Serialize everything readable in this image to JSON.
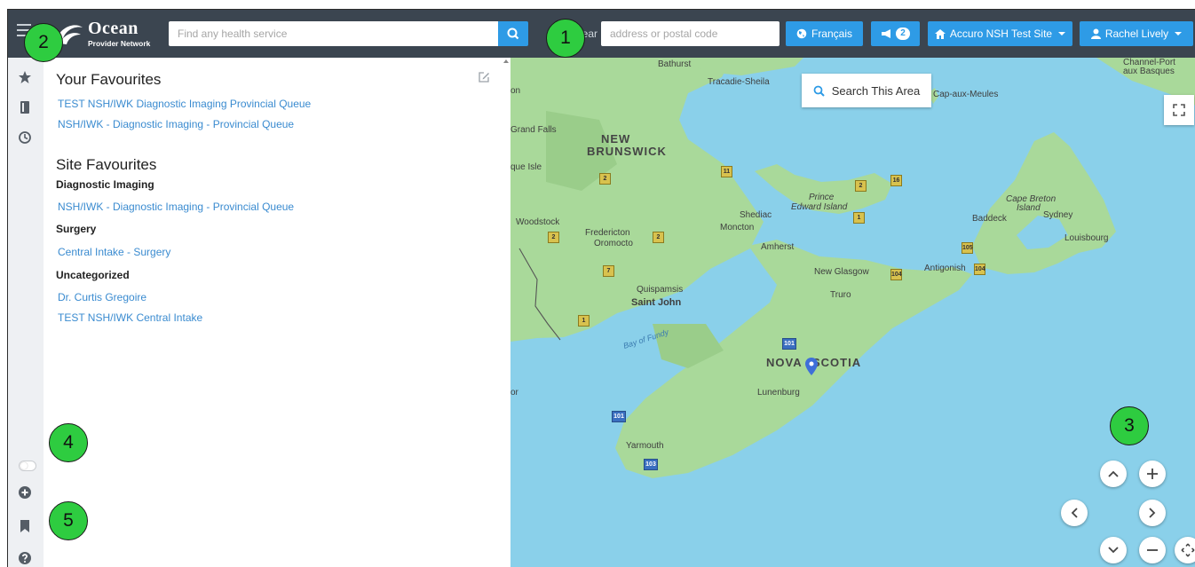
{
  "header": {
    "logo_name": "Ocean",
    "logo_sub": "Provider Network",
    "search_placeholder": "Find any health service",
    "near_label": "near",
    "address_placeholder": "address or postal code",
    "language_label": "Français",
    "announcements_count": "2",
    "site_label": "Accuro NSH Test Site",
    "user_label": "Rachel Lively"
  },
  "panel": {
    "your_favourites_title": "Your Favourites",
    "your_favourites": [
      "TEST NSH/IWK Diagnostic Imaging Provincial Queue",
      "NSH/IWK - Diagnostic Imaging - Provincial Queue"
    ],
    "site_favourites_title": "Site Favourites",
    "groups": [
      {
        "name": "Diagnostic Imaging",
        "items": [
          "NSH/IWK - Diagnostic Imaging - Provincial Queue"
        ]
      },
      {
        "name": "Surgery",
        "items": [
          "Central Intake - Surgery"
        ]
      },
      {
        "name": "Uncategorized",
        "items": [
          "Dr. Curtis Gregoire",
          "TEST NSH/IWK Central Intake"
        ]
      }
    ]
  },
  "map": {
    "search_area_label": "Search This Area",
    "labels": {
      "bathurst": "Bathurst",
      "tracadie": "Tracadie-Sheila",
      "cap_aux_meules": "Cap-aux-Meules",
      "channel_port": "Channel-Port",
      "aux_basques": "aux Basques",
      "grand_falls": "Grand Falls",
      "new": "NEW",
      "brunswick": "BRUNSWICK",
      "que_isle": "que Isle",
      "woodstock": "Woodstock",
      "fredericton": "Fredericton",
      "oromocto": "Oromocto",
      "shediac": "Shediac",
      "moncton": "Moncton",
      "prince": "Prince",
      "edward_island": "Edward Island",
      "cape": "Cape Breton",
      "island": "Island",
      "baddeck": "Baddeck",
      "sydney": "Sydney",
      "louisbourg": "Louisbourg",
      "amherst": "Amherst",
      "new_glasgow": "New Glasgow",
      "antigonish": "Antigonish",
      "truro": "Truro",
      "quispamsis": "Quispamsis",
      "saint_john": "Saint John",
      "bay_of_fundy": "Bay of Fundy",
      "nova": "NOVA",
      "scotia": "SCOTIA",
      "lunenburg": "Lunenburg",
      "yarmouth": "Yarmouth",
      "on": "on",
      "or": "or"
    },
    "shields": {
      "r1": "11",
      "r2": "2",
      "r3": "16",
      "r4": "1",
      "r5": "2",
      "r6": "2",
      "r7": "105",
      "r8": "104",
      "r9": "104",
      "r10": "7",
      "r11": "1",
      "r12": "101",
      "r13": "101",
      "r14": "103",
      "r15": "2"
    }
  },
  "callouts": [
    "1",
    "2",
    "3",
    "4",
    "5"
  ],
  "colors": {
    "topbar": "#3b4550",
    "accent": "#2e9be6",
    "link": "#3a8bd0",
    "callout": "#2ecc40",
    "water": "#8ad0ea",
    "land": "#a9d99a"
  }
}
